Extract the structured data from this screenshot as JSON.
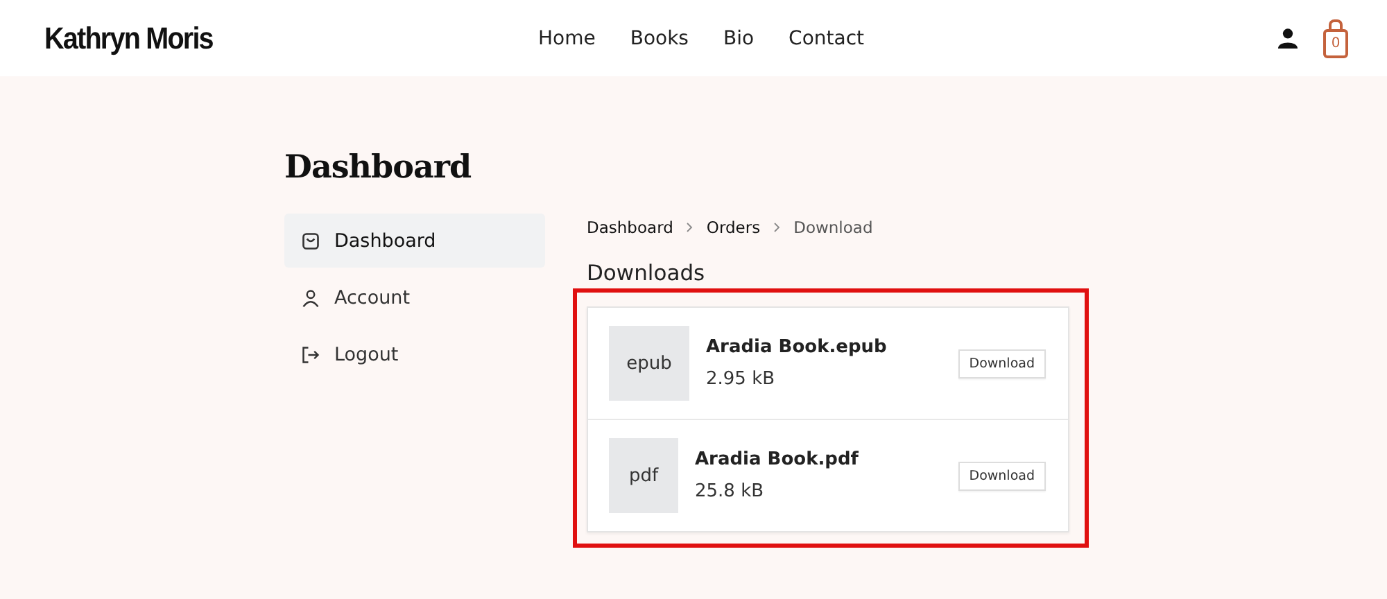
{
  "header": {
    "logo": "Kathryn Moris",
    "nav": [
      {
        "label": "Home"
      },
      {
        "label": "Books"
      },
      {
        "label": "Bio"
      },
      {
        "label": "Contact"
      }
    ],
    "cart_count": "0"
  },
  "page_title": "Dashboard",
  "sidebar": {
    "items": [
      {
        "label": "Dashboard",
        "selected": true
      },
      {
        "label": "Account",
        "selected": false
      },
      {
        "label": "Logout",
        "selected": false
      }
    ]
  },
  "breadcrumb": [
    {
      "label": "Dashboard",
      "current": false
    },
    {
      "label": "Orders",
      "current": false
    },
    {
      "label": "Download",
      "current": true
    }
  ],
  "downloads": {
    "title": "Downloads",
    "highlighted": true,
    "files": [
      {
        "type": "epub",
        "name": "Aradia Book.epub",
        "size": "2.95 kB",
        "button": "Download"
      },
      {
        "type": "pdf",
        "name": "Aradia Book.pdf",
        "size": "25.8 kB",
        "button": "Download"
      }
    ]
  }
}
